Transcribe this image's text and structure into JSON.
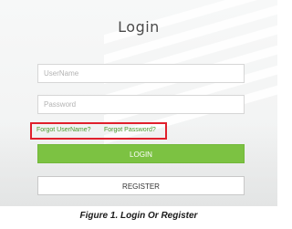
{
  "login": {
    "title": "Login",
    "username_placeholder": "UserName",
    "password_placeholder": "Password",
    "forgot_username": "Forgot UserName?",
    "forgot_password": "Forgot Password?",
    "login_button": "LOGIN",
    "register_button": "REGISTER"
  },
  "caption": "Figure 1. Login Or Register",
  "colors": {
    "accent_green": "#7cc242",
    "link_green": "#4a9a2c",
    "highlight_red": "#e0202c"
  }
}
